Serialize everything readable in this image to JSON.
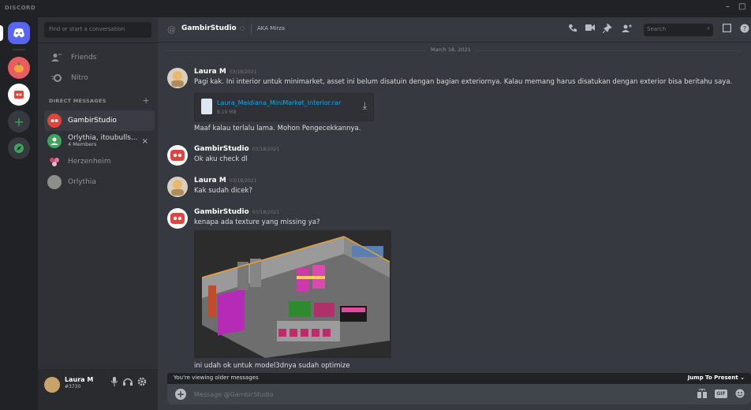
{
  "app": {
    "brand": "DISCORD"
  },
  "window": {
    "minimize": "–",
    "maximize": "□"
  },
  "sidebar": {
    "search_placeholder": "Find or start a conversation",
    "nav": [
      {
        "label": "Friends",
        "icon": "friends-icon"
      },
      {
        "label": "Nitro",
        "icon": "nitro-icon"
      }
    ],
    "dm_header": "DIRECT MESSAGES",
    "dm_add": "+",
    "dms": [
      {
        "name": "GambirStudio",
        "active": true,
        "color": "#e0443a"
      },
      {
        "name": "Orlythia, itoubulls...",
        "sub": "4 Members",
        "color": "#3ba55d",
        "close": "×"
      },
      {
        "name": "Herzenheim",
        "color": "#c94a6d"
      },
      {
        "name": "Orlythia",
        "color": "#8a8f88"
      }
    ]
  },
  "user": {
    "name": "Laura M",
    "tag": "#3730"
  },
  "header": {
    "title": "GambirStudio",
    "status": "○",
    "aka": "AKA  Mirza",
    "search_placeholder": "Search",
    "icons": [
      "call-icon",
      "video-icon",
      "pin-icon",
      "add-friend-icon",
      "inbox-icon",
      "help-icon"
    ]
  },
  "messages": {
    "date": "March 18, 2021",
    "items": [
      {
        "author": "Laura M",
        "time": "03/18/2021",
        "text": "Pagi kak. Ini interior untuk minimarket, asset ini belum disatuin dengan bagian exteriornya. Kalau memang harus disatukan dengan exterior bisa beritahu saya.",
        "attachment": {
          "name": "Laura_Meidiana_MiniMarket_Interior.rar",
          "size": "8.19 MB"
        },
        "followup": "Maaf kalau terlalu lama. Mohon Pengecekkannya."
      },
      {
        "author": "GambirStudio",
        "time": "03/18/2021",
        "text": "Ok aku check dl"
      },
      {
        "author": "Laura M",
        "time": "03/18/2021",
        "text": "Kak sudah dicek?"
      },
      {
        "author": "GambirStudio",
        "time": "03/18/2021",
        "text": "kenapa ada  texture yang missing ya?",
        "followup": "ini udah ok untuk model3dnya sudah optimize"
      }
    ]
  },
  "older_bar": {
    "label": "You're viewing older messages",
    "jump": "Jump To Present  ⌄"
  },
  "composer": {
    "placeholder": "Message @GambirStudio",
    "gif": "GIF"
  },
  "colors": {
    "accent": "#5865f2",
    "link": "#00aff4",
    "gambir_red": "#e0443a"
  }
}
